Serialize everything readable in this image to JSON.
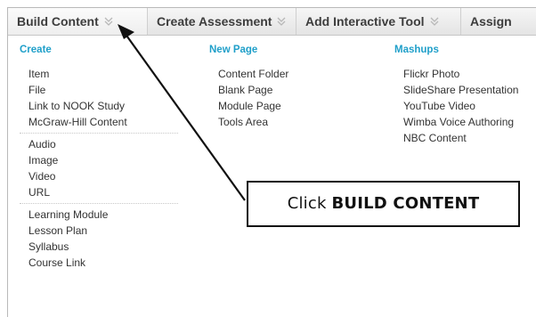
{
  "menubar": {
    "tabs": [
      {
        "label": "Build Content"
      },
      {
        "label": "Create Assessment"
      },
      {
        "label": "Add Interactive Tool"
      },
      {
        "label": "Assign"
      }
    ]
  },
  "columns": {
    "create": {
      "heading": "Create",
      "groups": [
        [
          "Item",
          "File",
          "Link to NOOK Study",
          "McGraw-Hill Content"
        ],
        [
          "Audio",
          "Image",
          "Video",
          "URL"
        ],
        [
          "Learning Module",
          "Lesson Plan",
          "Syllabus",
          "Course Link"
        ]
      ]
    },
    "new_page": {
      "heading": "New Page",
      "items": [
        "Content Folder",
        "Blank Page",
        "Module Page",
        "Tools Area"
      ]
    },
    "mashups": {
      "heading": "Mashups",
      "items": [
        "Flickr Photo",
        "SlideShare Presentation",
        "YouTube Video",
        "Wimba Voice Authoring",
        "NBC Content"
      ]
    }
  },
  "callout": {
    "prefix": "Click ",
    "emphasis": "BUILD CONTENT"
  },
  "colors": {
    "heading": "#1f9fc9",
    "text": "#333333",
    "tab_text": "#3d3d3d",
    "arrow": "#111111"
  },
  "icons": {
    "tab_dropdown": "double-chevron-down-icon"
  }
}
